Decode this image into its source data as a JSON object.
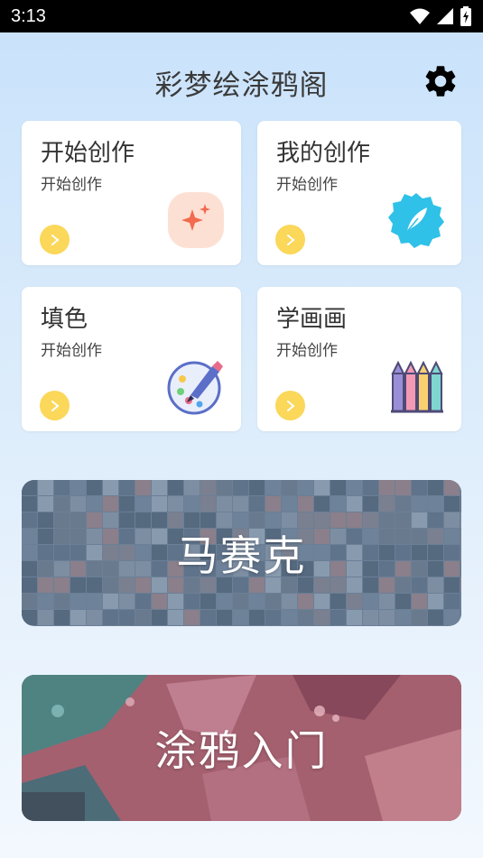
{
  "status_bar": {
    "time": "3:13"
  },
  "app": {
    "title": "彩梦绘涂鸦阁"
  },
  "cards": [
    {
      "title": "开始创作",
      "subtitle": "开始创作",
      "icon": "sparkle-icon"
    },
    {
      "title": "我的创作",
      "subtitle": "开始创作",
      "icon": "feather-badge-icon"
    },
    {
      "title": "填色",
      "subtitle": "开始创作",
      "icon": "palette-icon"
    },
    {
      "title": "学画画",
      "subtitle": "开始创作",
      "icon": "crayons-icon"
    }
  ],
  "banners": [
    {
      "label": "马赛克",
      "icon": "mosaic-pattern"
    },
    {
      "label": "涂鸦入门",
      "icon": "graffiti-pattern"
    }
  ],
  "colors": {
    "accent_yellow": "#fbd75a",
    "mosaic_bg": "#6b7f96",
    "graffiti_bg": "#9b5a6a",
    "sparkle_bg": "#fde0d4",
    "sparkle": "#f26a4f",
    "badge_bg": "#2fc1e8"
  }
}
